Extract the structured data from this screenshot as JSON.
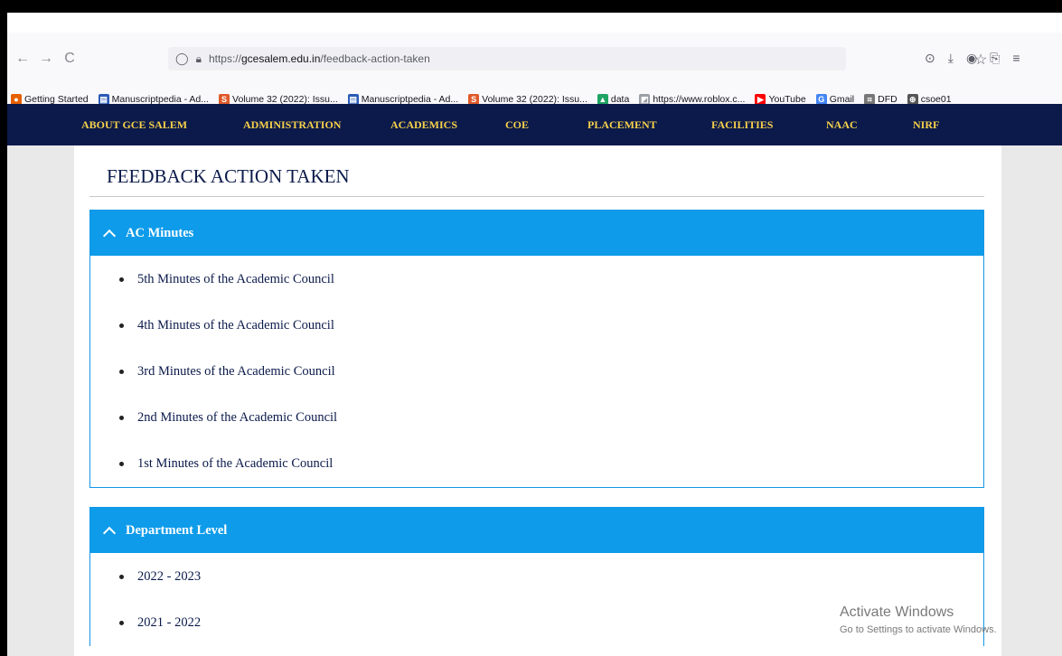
{
  "browser": {
    "url_prefix": "https://",
    "url_host": "gcesalem.edu.in",
    "url_path": "/feedback-action-taken",
    "back_icon": "←",
    "forward_icon": "→",
    "reload_icon": "C"
  },
  "bookmarks": [
    {
      "label": "Getting Started",
      "icon": "firefox-icon",
      "color": "#e66000",
      "glyph": "●"
    },
    {
      "label": "Manuscriptpedia - Ad...",
      "icon": "manuscriptpedia-icon",
      "color": "#2a5bb8",
      "glyph": "▤"
    },
    {
      "label": "Volume 32 (2022): Issu...",
      "icon": "volume-icon",
      "color": "#e05a2b",
      "glyph": "S"
    },
    {
      "label": "Manuscriptpedia - Ad...",
      "icon": "manuscriptpedia-icon",
      "color": "#2a5bb8",
      "glyph": "▤"
    },
    {
      "label": "Volume 32 (2022): Issu...",
      "icon": "volume-icon",
      "color": "#e05a2b",
      "glyph": "S"
    },
    {
      "label": "data",
      "icon": "drive-icon",
      "color": "#1fa463",
      "glyph": "▲"
    },
    {
      "label": "https://www.roblox.c...",
      "icon": "roblox-icon",
      "color": "#9aa0a6",
      "glyph": "◩"
    },
    {
      "label": "YouTube",
      "icon": "youtube-icon",
      "color": "#ff0000",
      "glyph": "▶"
    },
    {
      "label": "Gmail",
      "icon": "google-icon",
      "color": "#4285f4",
      "glyph": "G"
    },
    {
      "label": "DFD",
      "icon": "dfd-icon",
      "color": "#777777",
      "glyph": "⌗"
    },
    {
      "label": "csoe01",
      "icon": "globe-icon",
      "color": "#555555",
      "glyph": "⊕"
    }
  ],
  "sitenav": [
    "ABOUT GCE SALEM",
    "ADMINISTRATION",
    "ACADEMICS",
    "COE",
    "PLACEMENT",
    "FACILITIES",
    "NAAC",
    "NIRF"
  ],
  "page_title": "FEEDBACK ACTION TAKEN",
  "panels": [
    {
      "title": "AC Minutes",
      "items": [
        "5th Minutes of the Academic Council",
        "4th Minutes of the Academic Council",
        "3rd Minutes of the Academic Council",
        "2nd Minutes of the Academic Council",
        "1st Minutes of the Academic Council"
      ]
    },
    {
      "title": "Department Level",
      "items": [
        "2022 - 2023",
        "2021 - 2022"
      ]
    }
  ],
  "watermark": {
    "line1": "Activate Windows",
    "line2": "Go to Settings to activate Windows."
  },
  "colors": {
    "nav_bg": "#0b1a4a",
    "nav_text": "#f7d14a",
    "panel_head": "#0d9bea"
  }
}
